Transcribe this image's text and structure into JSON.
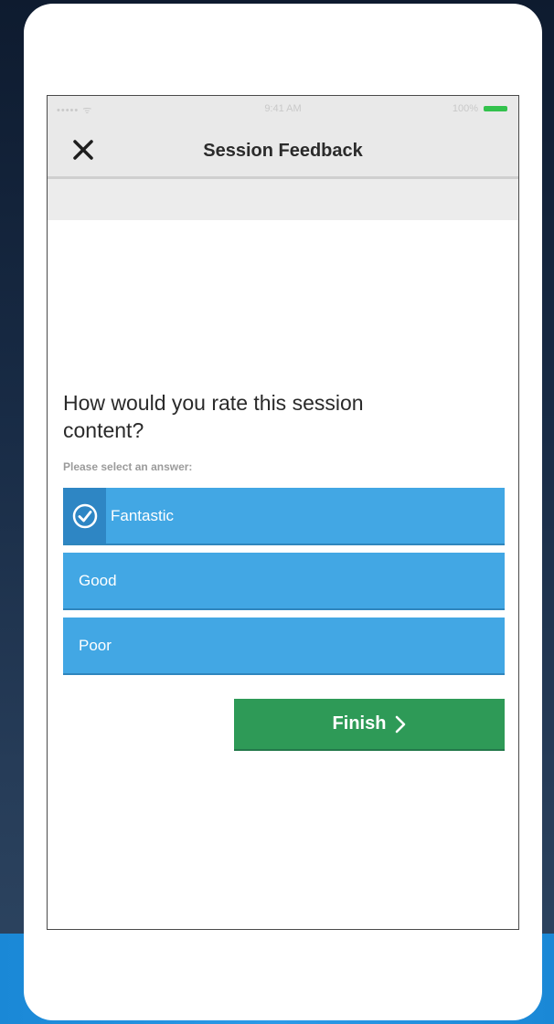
{
  "status_bar": {
    "carrier": "••••• ᯤ",
    "time": "9:41 AM",
    "battery": "100%"
  },
  "nav": {
    "title": "Session Feedback",
    "close_icon": "close-icon"
  },
  "question": {
    "text": "How would you rate this session content?",
    "prompt": "Please select an answer:"
  },
  "options": [
    {
      "label": "Fantastic",
      "selected": true
    },
    {
      "label": "Good",
      "selected": false
    },
    {
      "label": "Poor",
      "selected": false
    }
  ],
  "finish": {
    "label": "Finish",
    "icon": "chevron-right-icon"
  },
  "colors": {
    "option_bg": "#42a7e4",
    "selected_check_bg": "#2e86c4",
    "finish_bg": "#2e9a57"
  }
}
